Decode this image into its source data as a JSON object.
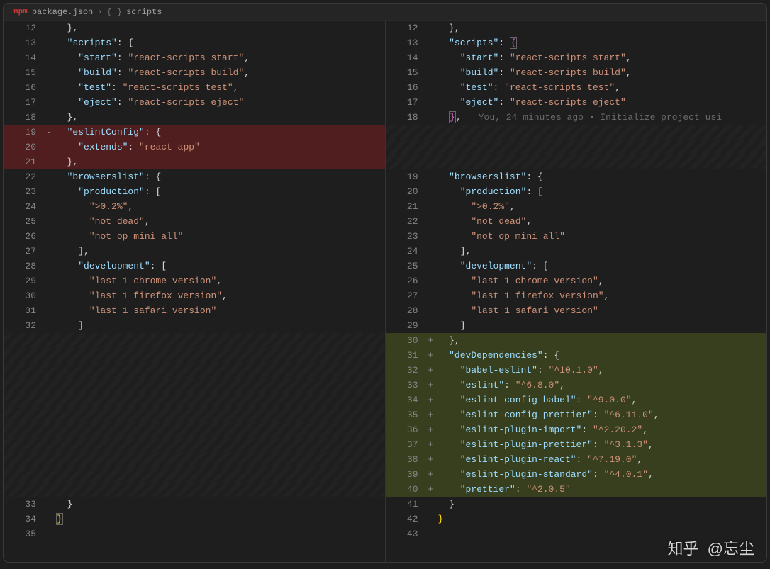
{
  "breadcrumb": {
    "file_icon": "npm",
    "file": "package.json",
    "braces": "{ }",
    "section": "scripts"
  },
  "blame_text": "You, 24 minutes ago • Initialize project usi",
  "watermark": {
    "logo": "知乎",
    "author": "@忘尘"
  },
  "left": {
    "lines": [
      {
        "n": "12",
        "indent": 1,
        "tokens": [
          {
            "t": "}",
            "c": "s-brace"
          },
          {
            "t": ",",
            "c": "s-punc"
          }
        ]
      },
      {
        "n": "13",
        "indent": 1,
        "tokens": [
          {
            "t": "\"scripts\"",
            "c": "s-key"
          },
          {
            "t": ": ",
            "c": "s-punc"
          },
          {
            "t": "{",
            "c": "s-brace"
          }
        ]
      },
      {
        "n": "14",
        "indent": 2,
        "tokens": [
          {
            "t": "\"start\"",
            "c": "s-key"
          },
          {
            "t": ": ",
            "c": "s-punc"
          },
          {
            "t": "\"react-scripts start\"",
            "c": "s-str"
          },
          {
            "t": ",",
            "c": "s-punc"
          }
        ]
      },
      {
        "n": "15",
        "indent": 2,
        "tokens": [
          {
            "t": "\"build\"",
            "c": "s-key"
          },
          {
            "t": ": ",
            "c": "s-punc"
          },
          {
            "t": "\"react-scripts build\"",
            "c": "s-str"
          },
          {
            "t": ",",
            "c": "s-punc"
          }
        ]
      },
      {
        "n": "16",
        "indent": 2,
        "tokens": [
          {
            "t": "\"test\"",
            "c": "s-key"
          },
          {
            "t": ": ",
            "c": "s-punc"
          },
          {
            "t": "\"react-scripts test\"",
            "c": "s-str"
          },
          {
            "t": ",",
            "c": "s-punc"
          }
        ]
      },
      {
        "n": "17",
        "indent": 2,
        "tokens": [
          {
            "t": "\"eject\"",
            "c": "s-key"
          },
          {
            "t": ": ",
            "c": "s-punc"
          },
          {
            "t": "\"react-scripts eject\"",
            "c": "s-str"
          }
        ]
      },
      {
        "n": "18",
        "indent": 1,
        "tokens": [
          {
            "t": "}",
            "c": "s-brace"
          },
          {
            "t": ",",
            "c": "s-punc"
          }
        ]
      },
      {
        "n": "19",
        "sign": "-",
        "flag": "removed",
        "indent": 1,
        "tokens": [
          {
            "t": "\"eslintConfig\"",
            "c": "s-key"
          },
          {
            "t": ": ",
            "c": "s-punc"
          },
          {
            "t": "{",
            "c": "s-brace"
          }
        ]
      },
      {
        "n": "20",
        "sign": "-",
        "flag": "removed",
        "indent": 2,
        "tokens": [
          {
            "t": "\"extends\"",
            "c": "s-key"
          },
          {
            "t": ": ",
            "c": "s-punc"
          },
          {
            "t": "\"react-app\"",
            "c": "s-str"
          }
        ]
      },
      {
        "n": "21",
        "sign": "-",
        "flag": "removed",
        "indent": 1,
        "tokens": [
          {
            "t": "}",
            "c": "s-brace"
          },
          {
            "t": ",",
            "c": "s-punc"
          }
        ]
      },
      {
        "n": "22",
        "indent": 1,
        "tokens": [
          {
            "t": "\"browserslist\"",
            "c": "s-key"
          },
          {
            "t": ": ",
            "c": "s-punc"
          },
          {
            "t": "{",
            "c": "s-brace"
          }
        ]
      },
      {
        "n": "23",
        "indent": 2,
        "tokens": [
          {
            "t": "\"production\"",
            "c": "s-key"
          },
          {
            "t": ": ",
            "c": "s-punc"
          },
          {
            "t": "[",
            "c": "s-brace"
          }
        ]
      },
      {
        "n": "24",
        "indent": 3,
        "tokens": [
          {
            "t": "\">0.2%\"",
            "c": "s-str"
          },
          {
            "t": ",",
            "c": "s-punc"
          }
        ]
      },
      {
        "n": "25",
        "indent": 3,
        "tokens": [
          {
            "t": "\"not dead\"",
            "c": "s-str"
          },
          {
            "t": ",",
            "c": "s-punc"
          }
        ]
      },
      {
        "n": "26",
        "indent": 3,
        "tokens": [
          {
            "t": "\"not op_mini all\"",
            "c": "s-str"
          }
        ]
      },
      {
        "n": "27",
        "indent": 2,
        "tokens": [
          {
            "t": "]",
            "c": "s-brace"
          },
          {
            "t": ",",
            "c": "s-punc"
          }
        ]
      },
      {
        "n": "28",
        "indent": 2,
        "tokens": [
          {
            "t": "\"development\"",
            "c": "s-key"
          },
          {
            "t": ": ",
            "c": "s-punc"
          },
          {
            "t": "[",
            "c": "s-brace"
          }
        ]
      },
      {
        "n": "29",
        "indent": 3,
        "tokens": [
          {
            "t": "\"last 1 chrome version\"",
            "c": "s-str"
          },
          {
            "t": ",",
            "c": "s-punc"
          }
        ]
      },
      {
        "n": "30",
        "indent": 3,
        "tokens": [
          {
            "t": "\"last 1 firefox version\"",
            "c": "s-str"
          },
          {
            "t": ",",
            "c": "s-punc"
          }
        ]
      },
      {
        "n": "31",
        "indent": 3,
        "tokens": [
          {
            "t": "\"last 1 safari version\"",
            "c": "s-str"
          }
        ]
      },
      {
        "n": "32",
        "indent": 2,
        "tokens": [
          {
            "t": "]",
            "c": "s-brace"
          }
        ]
      },
      {
        "flag": "hatch"
      },
      {
        "flag": "hatch"
      },
      {
        "flag": "hatch"
      },
      {
        "flag": "hatch"
      },
      {
        "flag": "hatch"
      },
      {
        "flag": "hatch"
      },
      {
        "flag": "hatch"
      },
      {
        "flag": "hatch"
      },
      {
        "flag": "hatch"
      },
      {
        "flag": "hatch"
      },
      {
        "flag": "hatch"
      },
      {
        "n": "33",
        "indent": 1,
        "tokens": [
          {
            "t": "}",
            "c": "s-brace"
          }
        ]
      },
      {
        "n": "34",
        "indent": 0,
        "tokens": [
          {
            "t": "}",
            "c": "s-brace-y",
            "box": true
          }
        ]
      },
      {
        "n": "35",
        "indent": 0,
        "tokens": []
      }
    ]
  },
  "right": {
    "lines": [
      {
        "n": "12",
        "indent": 1,
        "tokens": [
          {
            "t": "}",
            "c": "s-brace"
          },
          {
            "t": ",",
            "c": "s-punc"
          }
        ]
      },
      {
        "n": "13",
        "indent": 1,
        "tokens": [
          {
            "t": "\"scripts\"",
            "c": "s-key"
          },
          {
            "t": ": ",
            "c": "s-punc"
          },
          {
            "t": "{",
            "c": "s-brace-p",
            "box": true
          }
        ]
      },
      {
        "n": "14",
        "indent": 2,
        "tokens": [
          {
            "t": "\"start\"",
            "c": "s-key"
          },
          {
            "t": ": ",
            "c": "s-punc"
          },
          {
            "t": "\"react-scripts start\"",
            "c": "s-str"
          },
          {
            "t": ",",
            "c": "s-punc"
          }
        ]
      },
      {
        "n": "15",
        "indent": 2,
        "tokens": [
          {
            "t": "\"build\"",
            "c": "s-key"
          },
          {
            "t": ": ",
            "c": "s-punc"
          },
          {
            "t": "\"react-scripts build\"",
            "c": "s-str"
          },
          {
            "t": ",",
            "c": "s-punc"
          }
        ]
      },
      {
        "n": "16",
        "indent": 2,
        "tokens": [
          {
            "t": "\"test\"",
            "c": "s-key"
          },
          {
            "t": ": ",
            "c": "s-punc"
          },
          {
            "t": "\"react-scripts test\"",
            "c": "s-str"
          },
          {
            "t": ",",
            "c": "s-punc"
          }
        ]
      },
      {
        "n": "17",
        "indent": 2,
        "tokens": [
          {
            "t": "\"eject\"",
            "c": "s-key"
          },
          {
            "t": ": ",
            "c": "s-punc"
          },
          {
            "t": "\"react-scripts eject\"",
            "c": "s-str"
          }
        ]
      },
      {
        "n": "18",
        "indent": 1,
        "tokens": [
          {
            "t": "}",
            "c": "s-brace-p",
            "box": true
          },
          {
            "t": ",",
            "c": "s-punc"
          }
        ],
        "blame": true
      },
      {
        "flag": "hatch"
      },
      {
        "flag": "hatch"
      },
      {
        "flag": "hatch"
      },
      {
        "n": "19",
        "indent": 1,
        "tokens": [
          {
            "t": "\"browserslist\"",
            "c": "s-key"
          },
          {
            "t": ": ",
            "c": "s-punc"
          },
          {
            "t": "{",
            "c": "s-brace"
          }
        ]
      },
      {
        "n": "20",
        "indent": 2,
        "tokens": [
          {
            "t": "\"production\"",
            "c": "s-key"
          },
          {
            "t": ": ",
            "c": "s-punc"
          },
          {
            "t": "[",
            "c": "s-brace"
          }
        ]
      },
      {
        "n": "21",
        "indent": 3,
        "tokens": [
          {
            "t": "\">0.2%\"",
            "c": "s-str"
          },
          {
            "t": ",",
            "c": "s-punc"
          }
        ]
      },
      {
        "n": "22",
        "indent": 3,
        "tokens": [
          {
            "t": "\"not dead\"",
            "c": "s-str"
          },
          {
            "t": ",",
            "c": "s-punc"
          }
        ]
      },
      {
        "n": "23",
        "indent": 3,
        "tokens": [
          {
            "t": "\"not op_mini all\"",
            "c": "s-str"
          }
        ]
      },
      {
        "n": "24",
        "indent": 2,
        "tokens": [
          {
            "t": "]",
            "c": "s-brace"
          },
          {
            "t": ",",
            "c": "s-punc"
          }
        ]
      },
      {
        "n": "25",
        "indent": 2,
        "tokens": [
          {
            "t": "\"development\"",
            "c": "s-key"
          },
          {
            "t": ": ",
            "c": "s-punc"
          },
          {
            "t": "[",
            "c": "s-brace"
          }
        ]
      },
      {
        "n": "26",
        "indent": 3,
        "tokens": [
          {
            "t": "\"last 1 chrome version\"",
            "c": "s-str"
          },
          {
            "t": ",",
            "c": "s-punc"
          }
        ]
      },
      {
        "n": "27",
        "indent": 3,
        "tokens": [
          {
            "t": "\"last 1 firefox version\"",
            "c": "s-str"
          },
          {
            "t": ",",
            "c": "s-punc"
          }
        ]
      },
      {
        "n": "28",
        "indent": 3,
        "tokens": [
          {
            "t": "\"last 1 safari version\"",
            "c": "s-str"
          }
        ]
      },
      {
        "n": "29",
        "indent": 2,
        "tokens": [
          {
            "t": "]",
            "c": "s-brace"
          }
        ]
      },
      {
        "n": "30",
        "sign": "+",
        "flag": "added",
        "indent": 1,
        "tokens": [
          {
            "t": "}",
            "c": "s-brace"
          },
          {
            "t": ",",
            "c": "s-punc"
          }
        ]
      },
      {
        "n": "31",
        "sign": "+",
        "flag": "added",
        "indent": 1,
        "tokens": [
          {
            "t": "\"devDependencies\"",
            "c": "s-key"
          },
          {
            "t": ": ",
            "c": "s-punc"
          },
          {
            "t": "{",
            "c": "s-brace"
          }
        ]
      },
      {
        "n": "32",
        "sign": "+",
        "flag": "added",
        "indent": 2,
        "tokens": [
          {
            "t": "\"babel-eslint\"",
            "c": "s-key"
          },
          {
            "t": ": ",
            "c": "s-punc"
          },
          {
            "t": "\"^10.1.0\"",
            "c": "s-str"
          },
          {
            "t": ",",
            "c": "s-punc"
          }
        ]
      },
      {
        "n": "33",
        "sign": "+",
        "flag": "added",
        "indent": 2,
        "tokens": [
          {
            "t": "\"eslint\"",
            "c": "s-key"
          },
          {
            "t": ": ",
            "c": "s-punc"
          },
          {
            "t": "\"^6.8.0\"",
            "c": "s-str"
          },
          {
            "t": ",",
            "c": "s-punc"
          }
        ]
      },
      {
        "n": "34",
        "sign": "+",
        "flag": "added",
        "indent": 2,
        "tokens": [
          {
            "t": "\"eslint-config-babel\"",
            "c": "s-key"
          },
          {
            "t": ": ",
            "c": "s-punc"
          },
          {
            "t": "\"^9.0.0\"",
            "c": "s-str"
          },
          {
            "t": ",",
            "c": "s-punc"
          }
        ]
      },
      {
        "n": "35",
        "sign": "+",
        "flag": "added",
        "indent": 2,
        "tokens": [
          {
            "t": "\"eslint-config-prettier\"",
            "c": "s-key"
          },
          {
            "t": ": ",
            "c": "s-punc"
          },
          {
            "t": "\"^6.11.0\"",
            "c": "s-str"
          },
          {
            "t": ",",
            "c": "s-punc"
          }
        ]
      },
      {
        "n": "36",
        "sign": "+",
        "flag": "added",
        "indent": 2,
        "tokens": [
          {
            "t": "\"eslint-plugin-import\"",
            "c": "s-key"
          },
          {
            "t": ": ",
            "c": "s-punc"
          },
          {
            "t": "\"^2.20.2\"",
            "c": "s-str"
          },
          {
            "t": ",",
            "c": "s-punc"
          }
        ]
      },
      {
        "n": "37",
        "sign": "+",
        "flag": "added",
        "indent": 2,
        "tokens": [
          {
            "t": "\"eslint-plugin-prettier\"",
            "c": "s-key"
          },
          {
            "t": ": ",
            "c": "s-punc"
          },
          {
            "t": "\"^3.1.3\"",
            "c": "s-str"
          },
          {
            "t": ",",
            "c": "s-punc"
          }
        ]
      },
      {
        "n": "38",
        "sign": "+",
        "flag": "added",
        "indent": 2,
        "tokens": [
          {
            "t": "\"eslint-plugin-react\"",
            "c": "s-key"
          },
          {
            "t": ": ",
            "c": "s-punc"
          },
          {
            "t": "\"^7.19.0\"",
            "c": "s-str"
          },
          {
            "t": ",",
            "c": "s-punc"
          }
        ]
      },
      {
        "n": "39",
        "sign": "+",
        "flag": "added",
        "indent": 2,
        "tokens": [
          {
            "t": "\"eslint-plugin-standard\"",
            "c": "s-key"
          },
          {
            "t": ": ",
            "c": "s-punc"
          },
          {
            "t": "\"^4.0.1\"",
            "c": "s-str"
          },
          {
            "t": ",",
            "c": "s-punc"
          }
        ]
      },
      {
        "n": "40",
        "sign": "+",
        "flag": "added",
        "indent": 2,
        "tokens": [
          {
            "t": "\"prettier\"",
            "c": "s-key"
          },
          {
            "t": ": ",
            "c": "s-punc"
          },
          {
            "t": "\"^2.0.5\"",
            "c": "s-str"
          }
        ]
      },
      {
        "n": "41",
        "indent": 1,
        "tokens": [
          {
            "t": "}",
            "c": "s-brace"
          }
        ]
      },
      {
        "n": "42",
        "indent": 0,
        "tokens": [
          {
            "t": "}",
            "c": "s-brace-y"
          }
        ]
      },
      {
        "n": "43",
        "indent": 0,
        "tokens": []
      }
    ]
  }
}
